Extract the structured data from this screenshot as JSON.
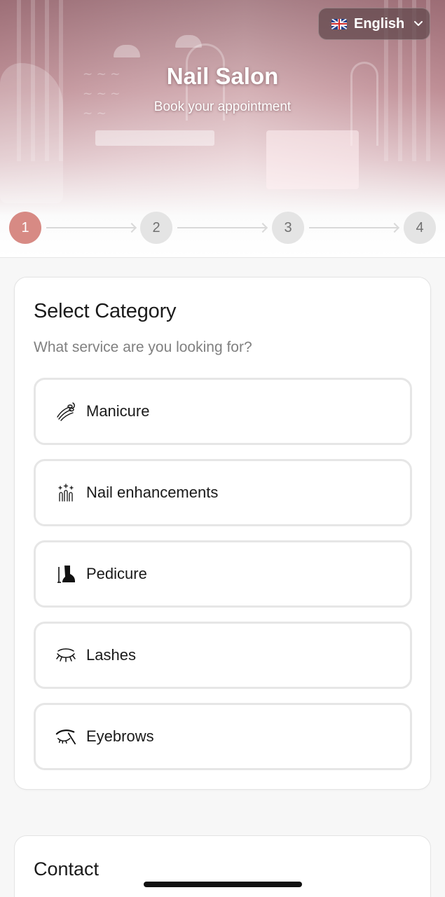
{
  "header": {
    "title": "Nail Salon",
    "subtitle": "Book your appointment",
    "language": {
      "label": "English",
      "flag": "uk-flag-icon"
    }
  },
  "stepper": {
    "steps": [
      "1",
      "2",
      "3",
      "4"
    ],
    "active_step": 1,
    "active_color": "#d78a84"
  },
  "category_card": {
    "title": "Select Category",
    "subtitle": "What service are you looking for?",
    "options": [
      {
        "label": "Manicure",
        "icon": "manicure-icon"
      },
      {
        "label": "Nail enhancements",
        "icon": "nail-enhancements-icon"
      },
      {
        "label": "Pedicure",
        "icon": "pedicure-icon"
      },
      {
        "label": "Lashes",
        "icon": "lashes-icon"
      },
      {
        "label": "Eyebrows",
        "icon": "eyebrows-icon"
      }
    ]
  },
  "contact_card": {
    "title": "Contact"
  }
}
